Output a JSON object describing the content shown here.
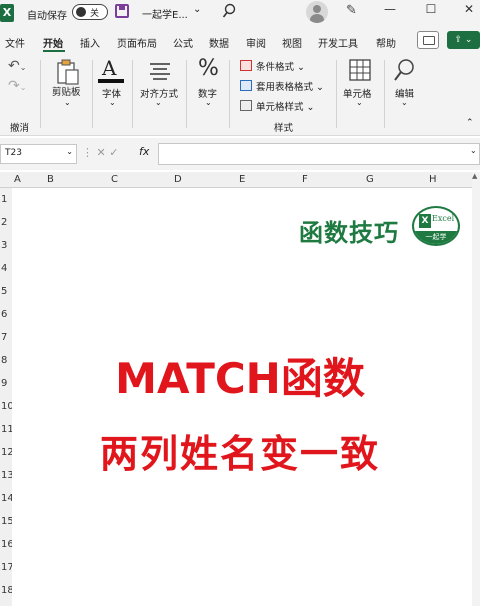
{
  "titlebar": {
    "logo_letter": "X",
    "autosave_label": "自动保存",
    "autosave_state": "关",
    "doc_title": "一起学E...",
    "chevron": "⌄",
    "minimize": "—",
    "maximize": "☐",
    "close": "✕"
  },
  "menu": {
    "tabs": [
      "文件",
      "开始",
      "插入",
      "页面布局",
      "公式",
      "数据",
      "审阅",
      "视图",
      "开发工具",
      "帮助"
    ],
    "active_tab": "开始"
  },
  "ribbon": {
    "undo_group": "撤消",
    "clipboard": "剪贴板",
    "font": "字体",
    "alignment": "对齐方式",
    "number": "数字",
    "conditional_format": "条件格式",
    "table_format": "套用表格格式",
    "cell_style": "单元格样式",
    "styles_group": "样式",
    "cells": "单元格",
    "editing": "编辑"
  },
  "formula_bar": {
    "name_box": "T23",
    "fx": "fx",
    "formula": ""
  },
  "columns": [
    "A",
    "B",
    "C",
    "D",
    "E",
    "F",
    "G",
    "H"
  ],
  "rows": [
    "1",
    "2",
    "3",
    "4",
    "5",
    "6",
    "7",
    "8",
    "9",
    "10",
    "11",
    "12",
    "13",
    "14",
    "15",
    "16",
    "17",
    "18"
  ],
  "content": {
    "brand": "函数技巧",
    "badge_text": "Excel",
    "badge_x": "X",
    "badge_bottom": "一起学",
    "headline1": "MATCH函数",
    "headline2": "两列姓名变一致"
  },
  "colors": {
    "accent_green": "#1f7a42",
    "headline_red": "#e0161c"
  }
}
